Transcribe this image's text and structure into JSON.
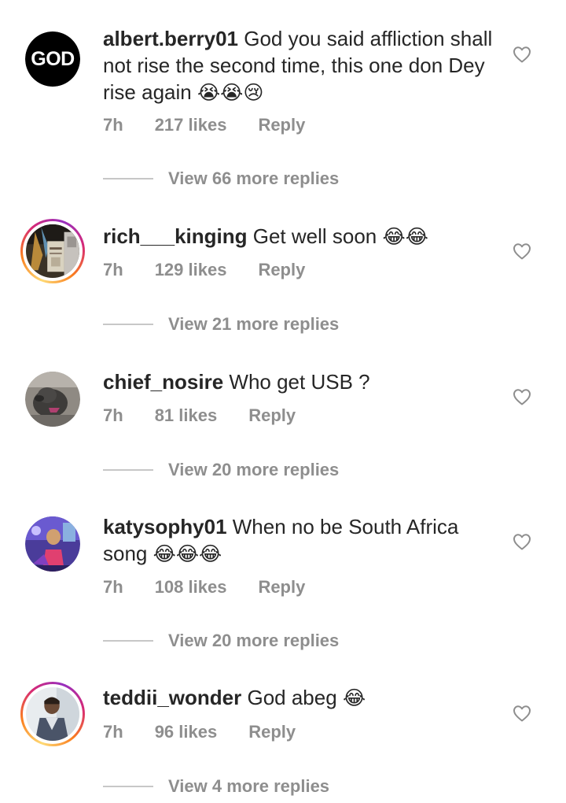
{
  "comments": [
    {
      "username": "albert.berry01",
      "text": "God you said affliction shall not rise the second time, this one don Dey rise again",
      "emoji": "😭😭😢",
      "time": "7h",
      "likes": "217 likes",
      "reply": "Reply",
      "view_replies": "View 66 more replies",
      "avatar_text": "GOD"
    },
    {
      "username": "rich___kinging",
      "text": "Get well soon",
      "emoji": "😂😂",
      "time": "7h",
      "likes": "129 likes",
      "reply": "Reply",
      "view_replies": "View 21 more replies"
    },
    {
      "username": "chief_nosire",
      "text": "Who get USB ?",
      "emoji": "",
      "time": "7h",
      "likes": "81 likes",
      "reply": "Reply",
      "view_replies": "View 20 more replies"
    },
    {
      "username": "katysophy01",
      "text": "When no be South Africa song",
      "emoji": "😂😂😂",
      "time": "7h",
      "likes": "108 likes",
      "reply": "Reply",
      "view_replies": "View 20 more replies"
    },
    {
      "username": "teddii_wonder",
      "text": "God abeg",
      "emoji": "😂",
      "time": "7h",
      "likes": "96 likes",
      "reply": "Reply",
      "view_replies": "View 4 more replies"
    }
  ],
  "colors": {
    "text": "#262626",
    "secondary": "#8e8e8e",
    "divider": "#c7c7c7"
  },
  "icons": {
    "like": "heart-outline-icon"
  }
}
